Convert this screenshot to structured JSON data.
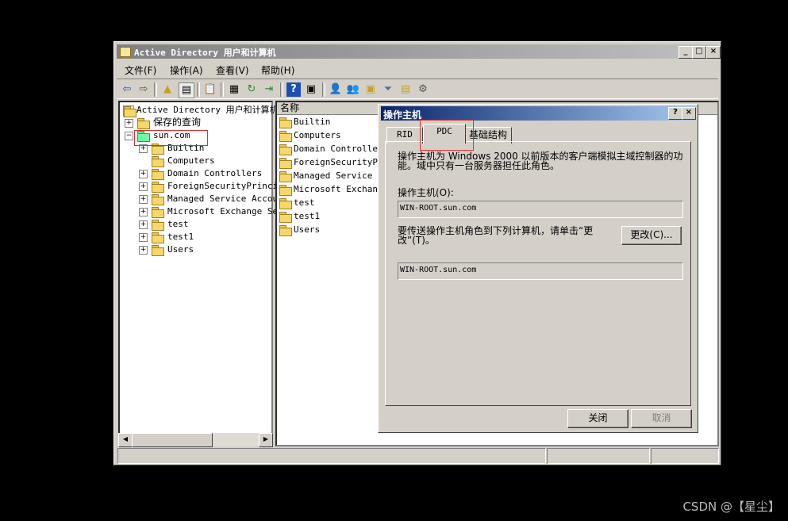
{
  "window": {
    "title": "Active Directory 用户和计算机",
    "controls": {
      "minimize": "_",
      "maximize": "□",
      "close": "×"
    }
  },
  "menubar": [
    "文件(F)",
    "操作(A)",
    "查看(V)",
    "帮助(H)"
  ],
  "toolbar": [
    "back-icon",
    "forward-icon",
    "up-folder-icon",
    "show-hide-tree-icon",
    "copy-icon",
    "properties-icon",
    "refresh-icon",
    "export-icon",
    "help-icon",
    "view-icon",
    "users-icon",
    "group-icon",
    "ou-icon",
    "filter-icon",
    "query-icon",
    "delegate-icon"
  ],
  "tree": {
    "root": "Active Directory 用户和计算机",
    "saved_queries": "保存的查询",
    "domain": "sun.com",
    "children": [
      "Builtin",
      "Computers",
      "Domain Controllers",
      "ForeignSecurityPrincip",
      "Managed Service Accour",
      "Microsoft Exchange Sec",
      "test",
      "test1",
      "Users"
    ]
  },
  "list": {
    "column_header": "名称",
    "items": [
      "Builtin",
      "Computers",
      "Domain Controllers",
      "ForeignSecurityPri",
      "Managed Service Ac",
      "Microsoft Exchange",
      "test",
      "test1",
      "Users"
    ]
  },
  "dialog": {
    "title": "操作主机",
    "help_btn": "?",
    "close_btn": "×",
    "tabs": [
      "RID",
      "PDC",
      "基础结构"
    ],
    "active_tab": "PDC",
    "description_line1": "操作主机为 Windows 2000 以前版本的客户端模拟主域控制器的功",
    "description_line2": "能。域中只有一台服务器担任此角色。",
    "master_label": "操作主机(O):",
    "master_value": "WIN-ROOT.sun.com",
    "transfer_line1": "要传送操作主机角色到下列计算机，请单击“更",
    "transfer_line2": "改”(T)。",
    "change_button": "更改(C)...",
    "target_value": "WIN-ROOT.sun.com",
    "close_button": "关闭",
    "cancel_button": "取消"
  },
  "watermark": "CSDN @【星尘】",
  "colors": {
    "highlight": "#e03030",
    "dialog_title": "#0a246a"
  }
}
